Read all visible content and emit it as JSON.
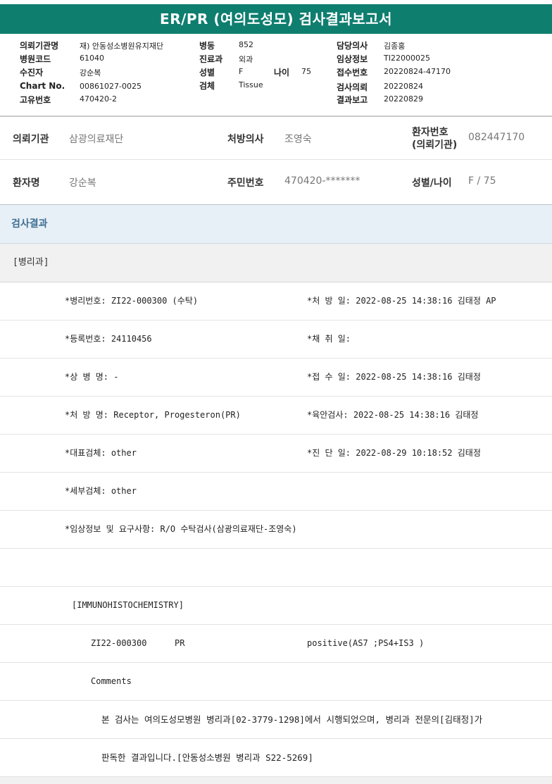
{
  "title": "ER/PR (여의도성모) 검사결과보고서",
  "header": {
    "col1": [
      {
        "label": "의뢰기관명",
        "value": "재) 안동성소병원유지재단"
      },
      {
        "label": "병원코드",
        "value": "61040"
      },
      {
        "label": "수진자",
        "value": "강순복"
      },
      {
        "label": "Chart No.",
        "value": "00861027-0025"
      },
      {
        "label": "고유번호",
        "value": "470420-2"
      }
    ],
    "col2": [
      {
        "label": "병동",
        "value": "852"
      },
      {
        "label": "진료과",
        "value": "외과"
      },
      {
        "label": "성별",
        "value": "F"
      },
      {
        "label": "검체",
        "value": "Tissue"
      }
    ],
    "age": {
      "label": "나이",
      "value": "75"
    },
    "col3": [
      {
        "label": "담당의사",
        "value": "김종홍"
      },
      {
        "label": "임상정보",
        "value": "TI22000025"
      },
      {
        "label": "접수번호",
        "value": "20220824-47170"
      },
      {
        "label": "검사의뢰",
        "value": "20220824"
      },
      {
        "label": "결과보고",
        "value": "20220829"
      }
    ]
  },
  "patient": {
    "institution_label": "의뢰기관",
    "institution": "삼광의료재단",
    "doctor_label": "처방의사",
    "doctor": "조영숙",
    "patient_no_label_1": "환자번호",
    "patient_no_label_2": "(의뢰기관)",
    "patient_no": "082447170",
    "name_label": "환자명",
    "name": "강순복",
    "rrn_label": "주민번호",
    "rrn": "470420-*******",
    "sexage_label": "성별/나이",
    "sexage": "F / 75"
  },
  "section_title": "검사결과",
  "department": "[병리과]",
  "results": {
    "r1_left": "*병리번호: ZI22-000300 (수탁)",
    "r1_right": "*처 방 일: 2022-08-25 14:38:16  김태정 AP",
    "r2_left": "*등록번호: 24110456",
    "r2_right": "*채 취 일:",
    "r3_left": "*상 병 명: -",
    "r3_right": "*접 수 일: 2022-08-25 14:38:16  김태정",
    "r4_left": "*처 방 명: Receptor, Progesteron(PR)",
    "r4_right": "*육안검사: 2022-08-25 14:38:16  김태정",
    "r5_left": "*대표검체: other",
    "r5_right": "*진 단 일: 2022-08-29 10:18:52  김태정",
    "r6_left": "*세부검체: other",
    "r7_left": "*임상정보 및 요구사항: R/O 수탁검사(삼광의료재단-조영숙)",
    "ihc_title": "[IMMUNOHISTOCHEMISTRY]",
    "ihc_no": "ZI22-000300",
    "ihc_marker": "PR",
    "ihc_result": "positive(AS7 ;PS4+IS3 )",
    "comments_label": "Comments",
    "comment_1": "본 검사는 여의도성모병원 병리과[02-3779-1298]에서 시행되었으며, 병리과 전문의[김태정]가",
    "comment_2": "판독한 결과입니다.[안동성소병원 병리과 S22-5269]"
  }
}
